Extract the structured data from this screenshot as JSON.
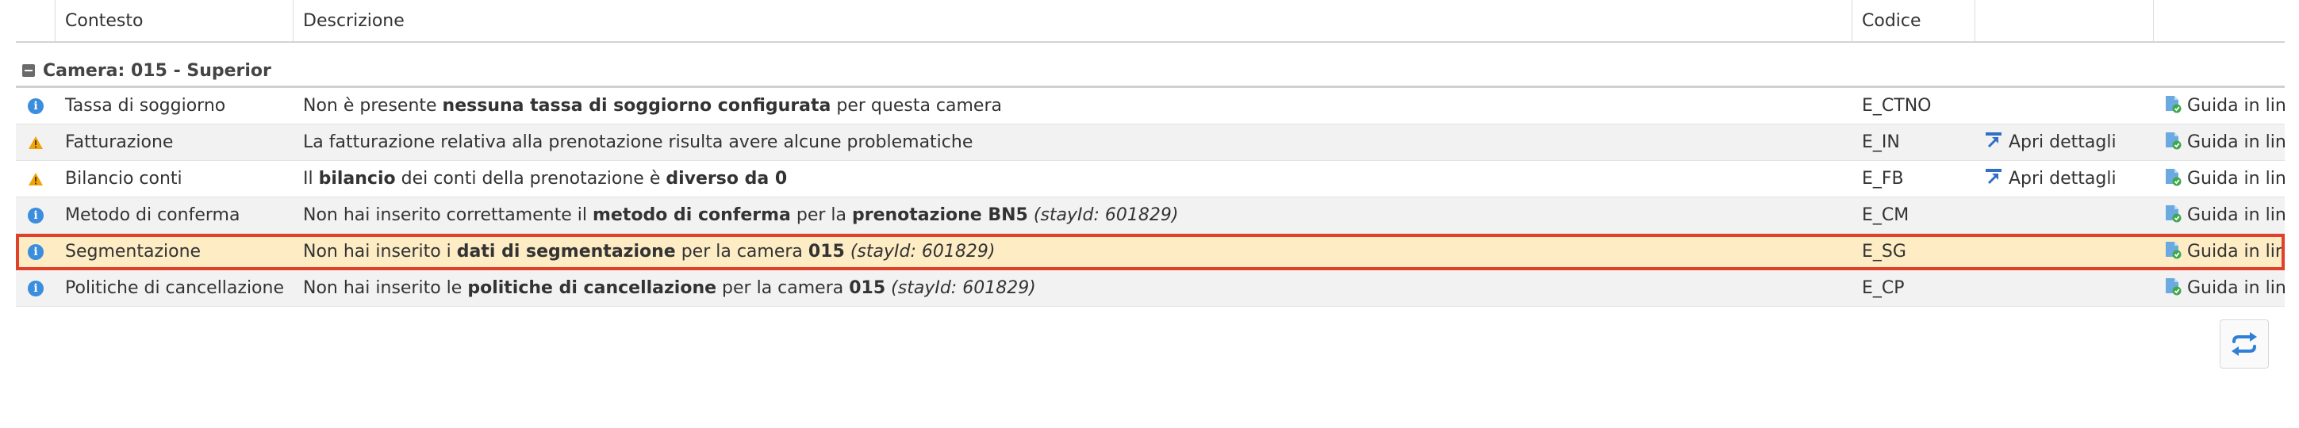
{
  "columns": {
    "context": "Contesto",
    "description": "Descrizione",
    "code": "Codice"
  },
  "group": {
    "title": "Camera: 015 - Superior"
  },
  "rows": [
    {
      "type": "info",
      "context": "Tassa di soggiorno",
      "description": [
        {
          "t": "Non è presente "
        },
        {
          "t": "nessuna tassa di soggiorno configurata",
          "b": true
        },
        {
          "t": " per questa camera"
        }
      ],
      "code": "E_CTNO",
      "details": "",
      "guide": "Guida in linea"
    },
    {
      "type": "warning",
      "context": "Fatturazione",
      "description": [
        {
          "t": "La fatturazione relativa alla prenotazione risulta avere alcune problematiche"
        }
      ],
      "code": "E_IN",
      "details": "Apri dettagli",
      "guide": "Guida in linea"
    },
    {
      "type": "warning",
      "context": "Bilancio conti",
      "description": [
        {
          "t": "Il "
        },
        {
          "t": "bilancio",
          "b": true
        },
        {
          "t": " dei conti della prenotazione è "
        },
        {
          "t": "diverso da 0",
          "b": true
        }
      ],
      "code": "E_FB",
      "details": "Apri dettagli",
      "guide": "Guida in linea"
    },
    {
      "type": "info",
      "context": "Metodo di conferma",
      "description": [
        {
          "t": "Non hai inserito correttamente il "
        },
        {
          "t": "metodo di conferma",
          "b": true
        },
        {
          "t": " per la "
        },
        {
          "t": "prenotazione BN5",
          "b": true
        },
        {
          "t": " "
        },
        {
          "t": "(stayId: 601829)",
          "i": true
        }
      ],
      "code": "E_CM",
      "details": "",
      "guide": "Guida in linea"
    },
    {
      "type": "info",
      "context": "Segmentazione",
      "selected": true,
      "description": [
        {
          "t": "Non hai inserito i "
        },
        {
          "t": "dati di segmentazione",
          "b": true
        },
        {
          "t": " per la camera "
        },
        {
          "t": "015",
          "b": true
        },
        {
          "t": " "
        },
        {
          "t": "(stayId: 601829)",
          "i": true
        }
      ],
      "code": "E_SG",
      "details": "",
      "guide": "Guida in linea"
    },
    {
      "type": "info",
      "context": "Politiche di cancellazione",
      "description": [
        {
          "t": "Non hai inserito le "
        },
        {
          "t": "politiche di cancellazione",
          "b": true
        },
        {
          "t": " per la camera "
        },
        {
          "t": "015",
          "b": true
        },
        {
          "t": " "
        },
        {
          "t": "(stayId: 601829)",
          "i": true
        }
      ],
      "code": "E_CP",
      "details": "",
      "guide": "Guida in linea"
    }
  ],
  "icons": {
    "info": "info-icon",
    "warning": "warning-icon",
    "details": "open-details-icon",
    "guide": "online-guide-icon",
    "refresh": "refresh-icon",
    "group_toggle": "collapse-icon"
  },
  "colors": {
    "selected_row_bg": "#fdecc4",
    "selected_row_border": "#e0412b",
    "info_blue": "#3b8ddd",
    "warning_orange": "#f0a30a",
    "alt_row_bg": "#f2f2f2"
  }
}
